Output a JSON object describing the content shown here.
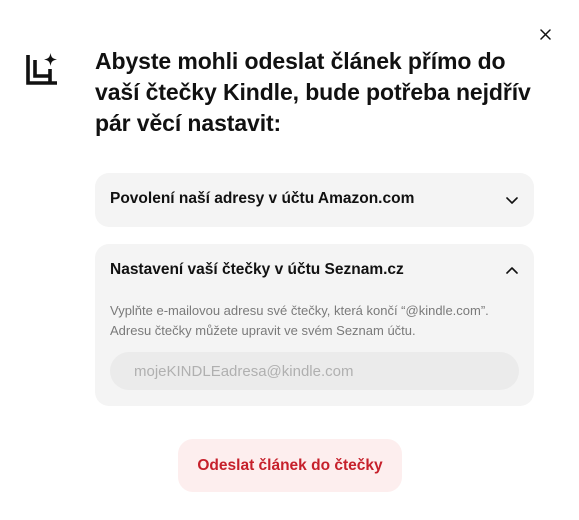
{
  "dialog": {
    "title": "Abyste mohli odeslat článek přímo do vaší čtečky Kindle, bude potřeba nejdřív pár věcí nastavit:",
    "header_icon": "document-sparkle-icon",
    "close_icon": "close-icon"
  },
  "accordions": [
    {
      "title": "Povolení naší adresy v účtu Amazon.com",
      "expanded": false,
      "chevron_icon": "chevron-down-icon"
    },
    {
      "title": "Nastavení vaší čtečky v účtu Seznam.cz",
      "expanded": true,
      "chevron_icon": "chevron-up-icon",
      "description": "Vyplňte e-mailovou adresu své čtečky, která končí “@kindle.com”. Adresu čtečky můžete upravit ve svém Seznam účtu.",
      "input": {
        "value": "",
        "placeholder": "mojeKINDLEadresa@kindle.com"
      }
    }
  ],
  "submit": {
    "label": "Odeslat článek do čtečky"
  },
  "colors": {
    "accent": "#c6202b",
    "accent_bg": "#fdeeee",
    "panel_bg": "#f4f4f4",
    "input_bg": "#ebebeb"
  }
}
